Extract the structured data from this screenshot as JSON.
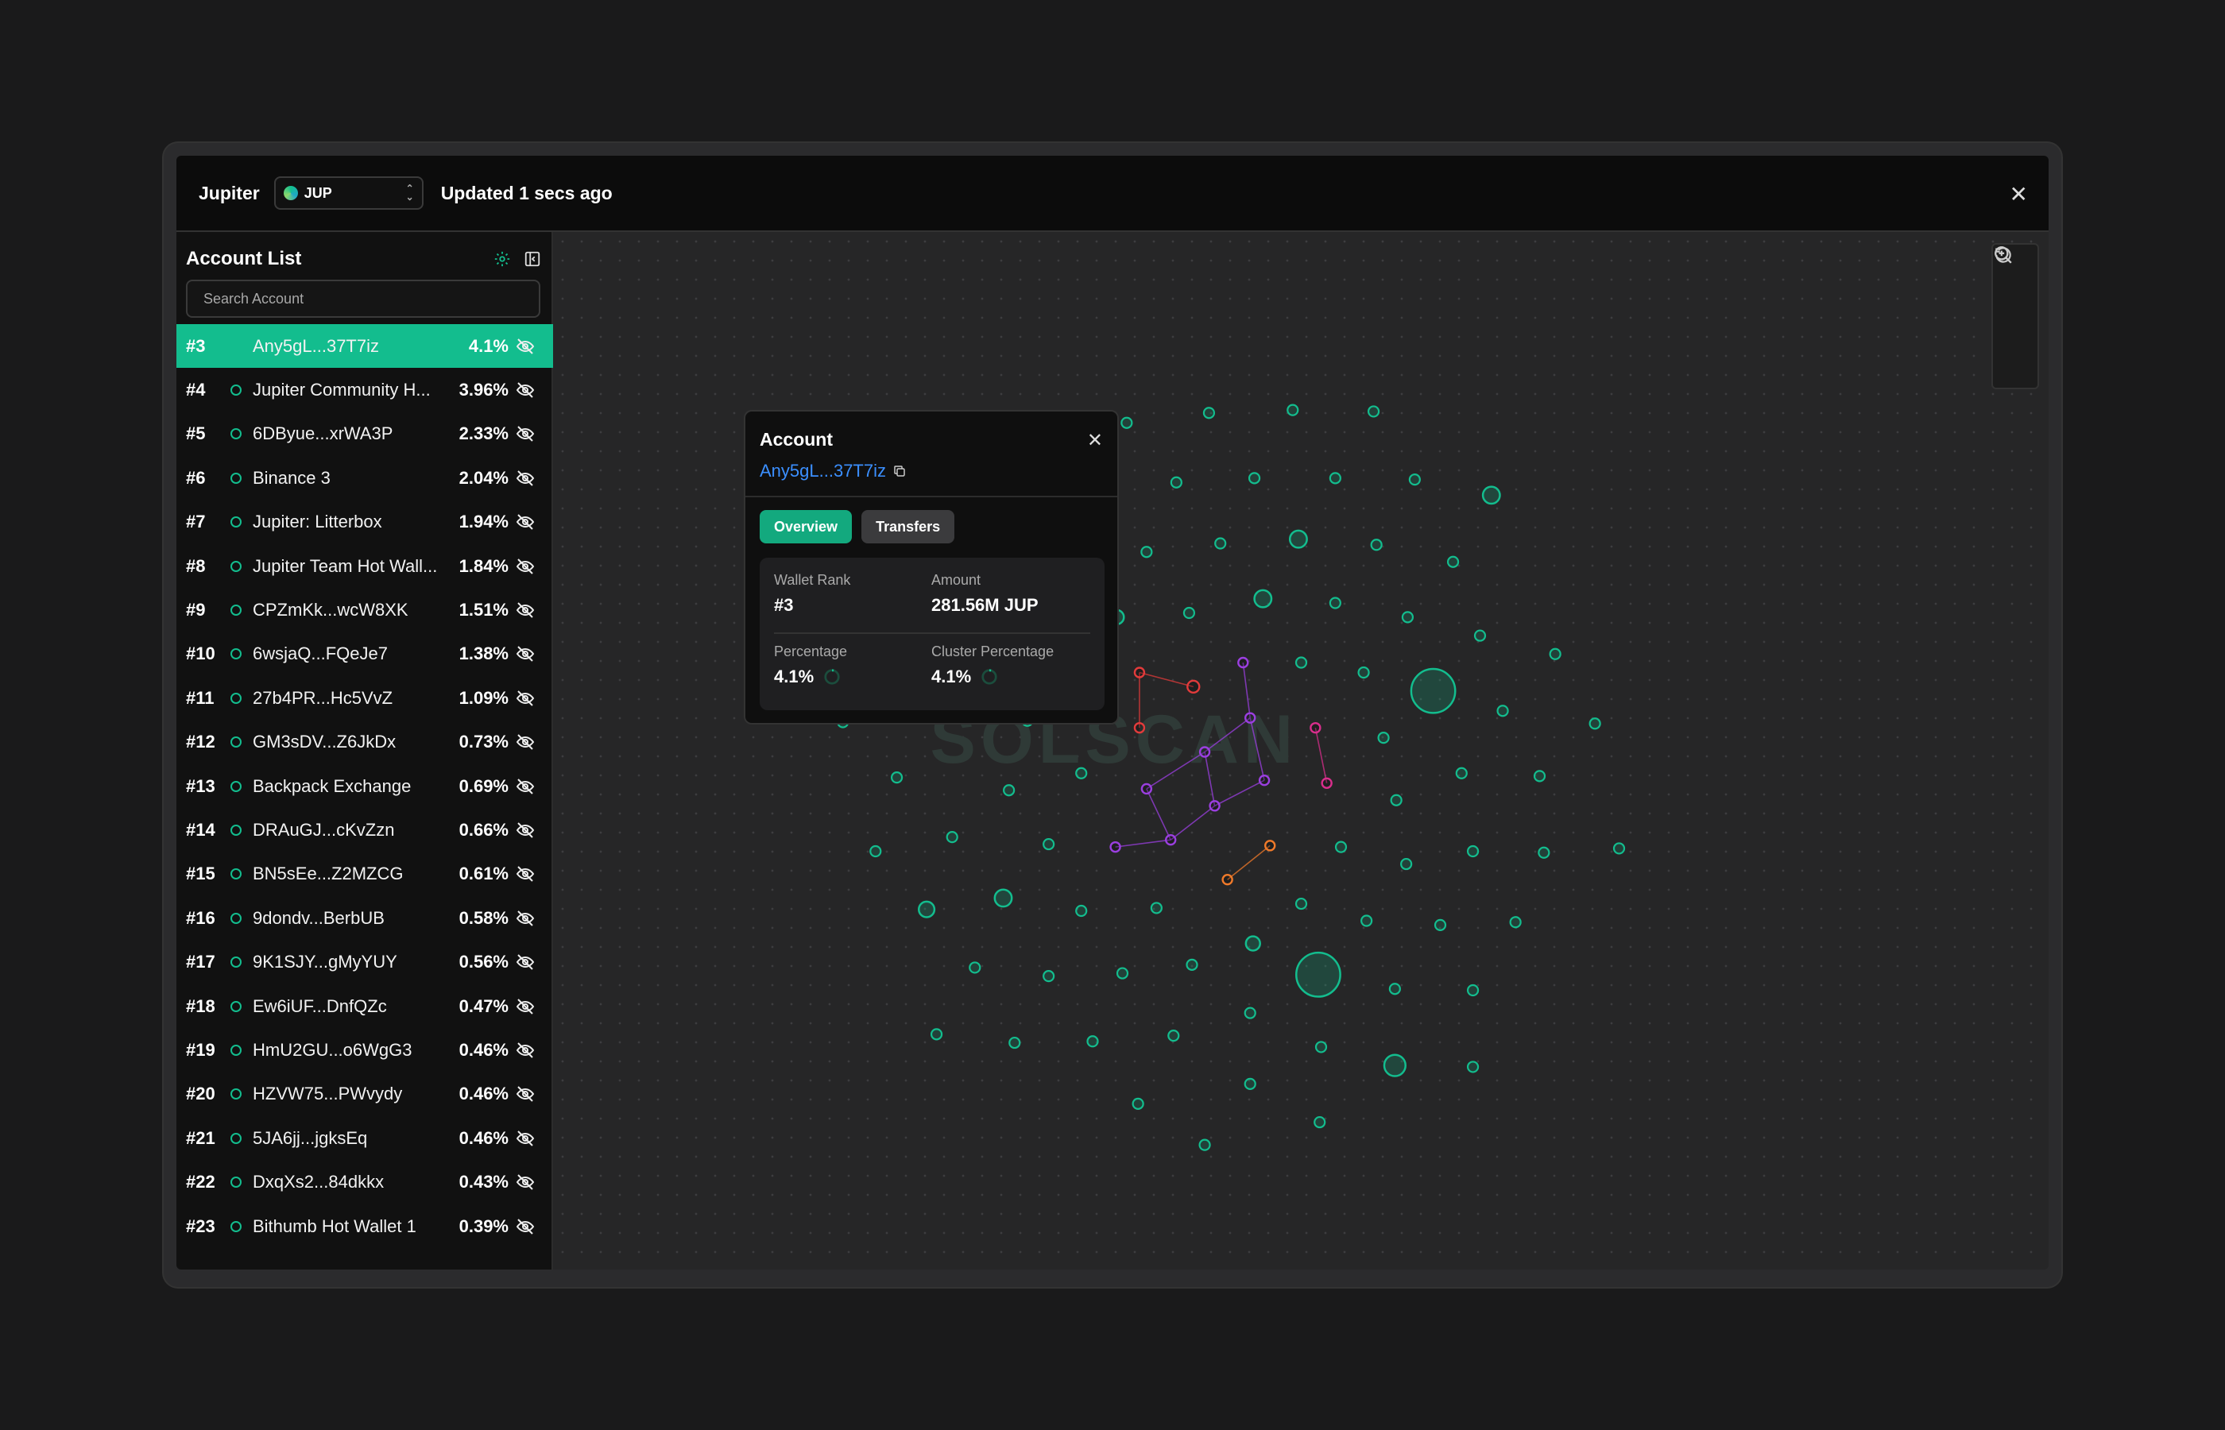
{
  "header": {
    "app_title": "Jupiter",
    "token": "JUP",
    "updated": "Updated 1 secs ago"
  },
  "sidebar": {
    "title": "Account List",
    "search_placeholder": "Search Account",
    "accounts": [
      {
        "rank": "#3",
        "name": "Any5gL...37T7iz",
        "pct": "4.1%",
        "active": true
      },
      {
        "rank": "#4",
        "name": "Jupiter Community H...",
        "pct": "3.96%"
      },
      {
        "rank": "#5",
        "name": "6DByue...xrWA3P",
        "pct": "2.33%"
      },
      {
        "rank": "#6",
        "name": "Binance 3",
        "pct": "2.04%"
      },
      {
        "rank": "#7",
        "name": "Jupiter: Litterbox",
        "pct": "1.94%"
      },
      {
        "rank": "#8",
        "name": "Jupiter Team Hot Wall...",
        "pct": "1.84%"
      },
      {
        "rank": "#9",
        "name": "CPZmKk...wcW8XK",
        "pct": "1.51%"
      },
      {
        "rank": "#10",
        "name": "6wsjaQ...FQeJe7",
        "pct": "1.38%"
      },
      {
        "rank": "#11",
        "name": "27b4PR...Hc5VvZ",
        "pct": "1.09%"
      },
      {
        "rank": "#12",
        "name": "GM3sDV...Z6JkDx",
        "pct": "0.73%"
      },
      {
        "rank": "#13",
        "name": "Backpack Exchange",
        "pct": "0.69%"
      },
      {
        "rank": "#14",
        "name": "DRAuGJ...cKvZzn",
        "pct": "0.66%"
      },
      {
        "rank": "#15",
        "name": "BN5sEe...Z2MZCG",
        "pct": "0.61%"
      },
      {
        "rank": "#16",
        "name": "9dondv...BerbUB",
        "pct": "0.58%"
      },
      {
        "rank": "#17",
        "name": "9K1SJY...gMyYUY",
        "pct": "0.56%"
      },
      {
        "rank": "#18",
        "name": "Ew6iUF...DnfQZc",
        "pct": "0.47%"
      },
      {
        "rank": "#19",
        "name": "HmU2GU...o6WgG3",
        "pct": "0.46%"
      },
      {
        "rank": "#20",
        "name": "HZVW75...PWvydy",
        "pct": "0.46%"
      },
      {
        "rank": "#21",
        "name": "5JA6jj...jgksEq",
        "pct": "0.46%"
      },
      {
        "rank": "#22",
        "name": "DxqXs2...84dkkx",
        "pct": "0.43%"
      },
      {
        "rank": "#23",
        "name": "Bithumb Hot Wallet 1",
        "pct": "0.39%"
      }
    ]
  },
  "popup": {
    "title": "Account",
    "address": "Any5gL...37T7iz",
    "tab_overview": "Overview",
    "tab_transfers": "Transfers",
    "wallet_rank_label": "Wallet Rank",
    "wallet_rank": "#3",
    "amount_label": "Amount",
    "amount": "281.56M JUP",
    "percentage_label": "Percentage",
    "percentage": "4.1%",
    "cluster_label": "Cluster Percentage",
    "cluster_percentage": "4.1%"
  },
  "graph": {
    "watermark": "SOLSCAN",
    "colors": {
      "node": "#13bd8e",
      "cluster_red": "#e23b3b",
      "cluster_purple": "#9b3fe0",
      "cluster_magenta": "#d92e8c",
      "cluster_orange": "#f07a2a"
    },
    "controls": [
      "refresh-icon",
      "zoom-in-icon",
      "zoom-out-icon"
    ]
  }
}
